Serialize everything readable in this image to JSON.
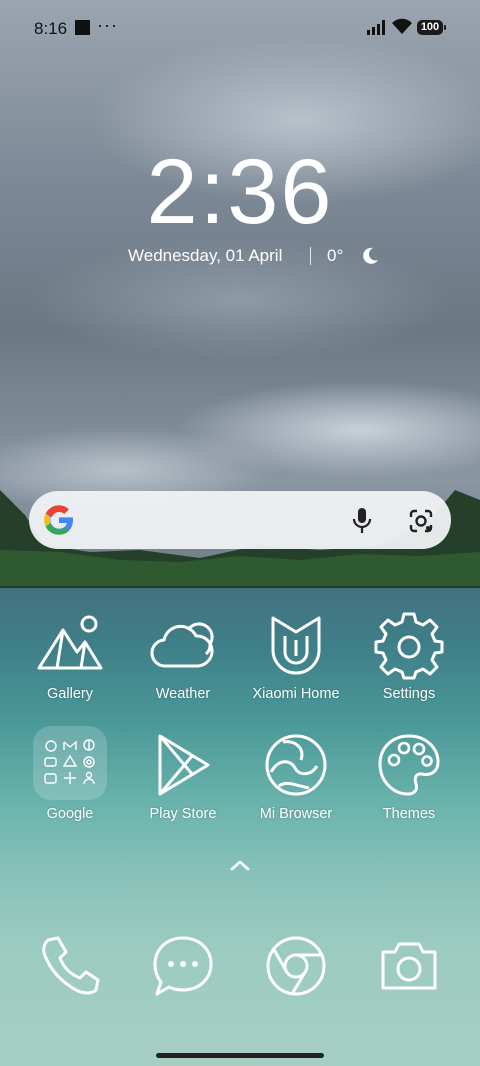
{
  "status_bar": {
    "time": "8:16",
    "battery": "100",
    "icons": [
      "notification-square-icon",
      "more-dots-icon",
      "signal-icon",
      "wifi-icon",
      "battery-icon"
    ]
  },
  "lock": {
    "clock": "2:36",
    "date": "Wednesday, 01 April",
    "temperature": "0°",
    "weather_icon": "moon-icon"
  },
  "search_bar": {
    "icons": [
      "google-g-icon",
      "microphone-icon",
      "google-lens-icon"
    ]
  },
  "apps": {
    "row1": [
      {
        "label": "Gallery",
        "icon": "mountain-icon"
      },
      {
        "label": "Weather",
        "icon": "cloud-icon"
      },
      {
        "label": "Xiaomi Home",
        "icon": "mi-home-icon"
      },
      {
        "label": "Settings",
        "icon": "gear-icon"
      }
    ],
    "row2": [
      {
        "label": "Google",
        "icon": "folder-icon"
      },
      {
        "label": "Play Store",
        "icon": "play-triangle-icon"
      },
      {
        "label": "Mi Browser",
        "icon": "browser-wave-icon"
      },
      {
        "label": "Themes",
        "icon": "palette-icon"
      }
    ]
  },
  "dock": [
    {
      "icon": "phone-icon"
    },
    {
      "icon": "messages-icon"
    },
    {
      "icon": "chrome-icon"
    },
    {
      "icon": "camera-icon"
    }
  ],
  "colors": {
    "sky": "#7d8996",
    "sea": "#4a9898",
    "icon_stroke": "#ffffff",
    "google_blue": "#4285F4",
    "google_red": "#EA4335",
    "google_yellow": "#FBBC05",
    "google_green": "#34A853"
  }
}
